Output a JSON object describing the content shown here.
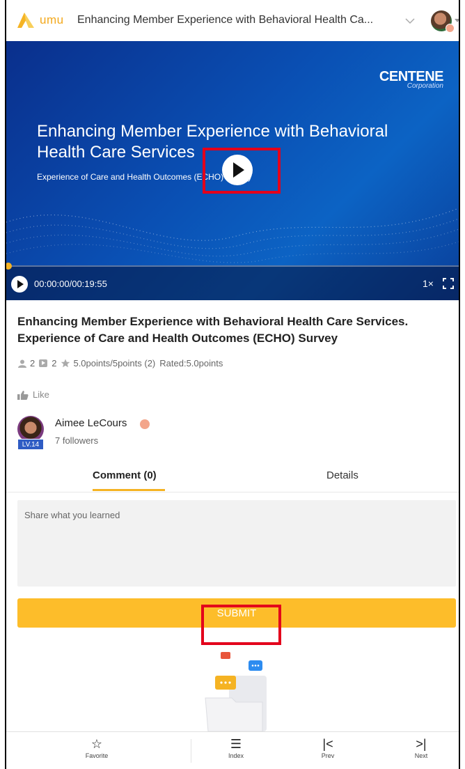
{
  "header": {
    "logo_text": "umu",
    "title": "Enhancing Member Experience with Behavioral Health Ca..."
  },
  "video": {
    "brand_main": "CENTENE",
    "brand_sub": "Corporation",
    "slide_title": "Enhancing Member Experience with Behavioral Health Care Services",
    "slide_subtitle": "Experience of Care and Health Outcomes (ECHO) Survey",
    "time": "00:00:00/00:19:55",
    "speed": "1×",
    "progress": 0.0
  },
  "course": {
    "title": "Enhancing Member Experience with Behavioral Health Care Services. Experience of Care and Health Outcomes (ECHO) Survey",
    "participants": "2",
    "videos": "2",
    "points": "5.0points/5points (2)",
    "rated": "Rated:5.0points",
    "like_label": "Like"
  },
  "author": {
    "level": "LV.14",
    "name": "Aimee LeCours",
    "followers": "7 followers"
  },
  "tabs": {
    "comment": "Comment (0)",
    "details": "Details"
  },
  "comment_box": {
    "placeholder": "Share what you learned",
    "submit_label": "SUBMIT"
  },
  "bottom_nav": {
    "favorite": "Favorite",
    "index": "Index",
    "prev": "Prev",
    "next": "Next"
  },
  "colors": {
    "accent": "#fdbd2a",
    "highlight": "#e3001b",
    "video_bg": "#0a4fb3"
  }
}
